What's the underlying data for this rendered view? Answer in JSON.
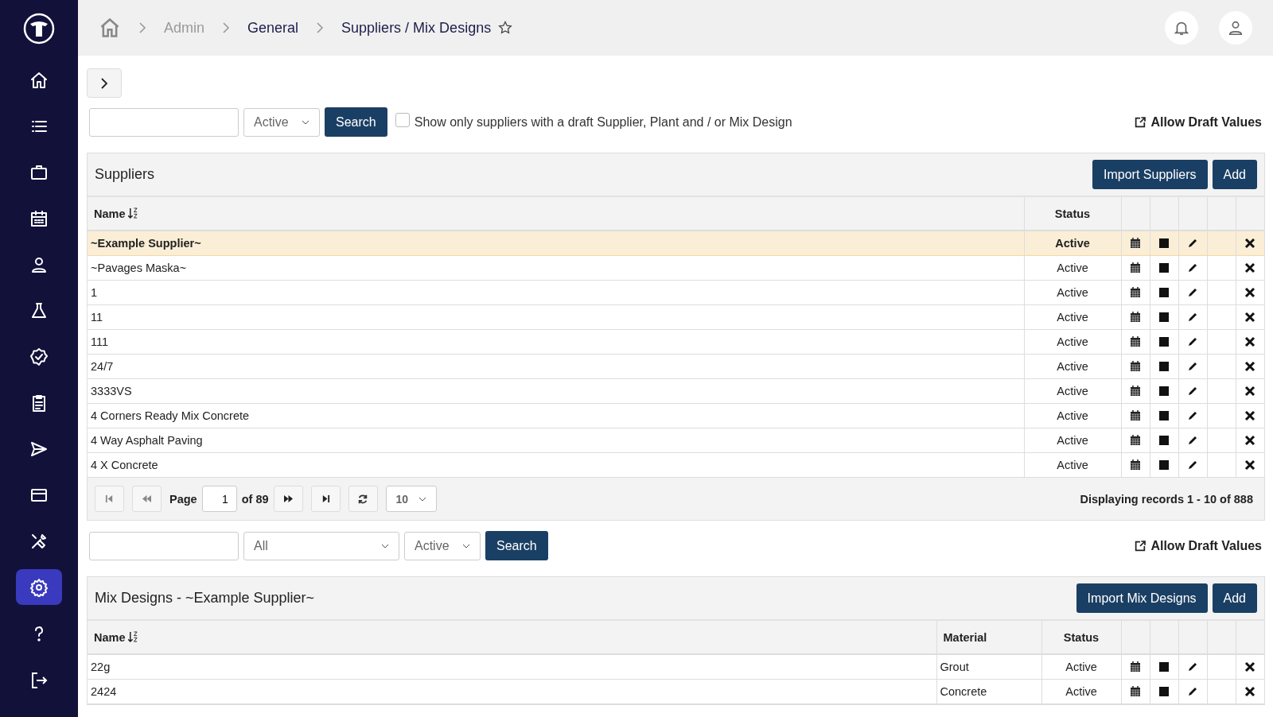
{
  "sidebar": {
    "items": [
      {
        "kind": "home",
        "selected": false
      },
      {
        "kind": "list",
        "selected": false
      },
      {
        "kind": "briefcase",
        "selected": false
      },
      {
        "kind": "calendar",
        "selected": false
      },
      {
        "kind": "person",
        "selected": false
      },
      {
        "kind": "flask",
        "selected": false
      },
      {
        "kind": "badge",
        "selected": false
      },
      {
        "kind": "clipboard",
        "selected": false
      },
      {
        "kind": "send",
        "selected": false
      },
      {
        "kind": "card",
        "selected": false
      },
      {
        "kind": "tools",
        "selected": false
      },
      {
        "kind": "gear",
        "selected": true
      },
      {
        "kind": "help",
        "selected": false
      }
    ]
  },
  "breadcrumb": [
    {
      "label": "Admin",
      "kind": "muted"
    },
    {
      "label": "General",
      "kind": "link"
    },
    {
      "label": "Suppliers / Mix Designs",
      "kind": "current"
    }
  ],
  "supplier_filter": {
    "status": "Active",
    "search_button": "Search",
    "draft_checkbox": {
      "label": "Show only suppliers with a draft Supplier, Plant and / or Mix Design",
      "checked": false
    },
    "allow_draft": "Allow Draft Values"
  },
  "suppliers": {
    "title": "Suppliers",
    "buttons": [
      "Import Suppliers",
      "Add"
    ],
    "columns": [
      "Name",
      "Status"
    ],
    "rows": [
      {
        "name": "~Example Supplier~",
        "status": "Active",
        "selected": true
      },
      {
        "name": "~Pavages Maska~",
        "status": "Active",
        "selected": false
      },
      {
        "name": "1",
        "status": "Active",
        "selected": false
      },
      {
        "name": "11",
        "status": "Active",
        "selected": false
      },
      {
        "name": "111",
        "status": "Active",
        "selected": false
      },
      {
        "name": "24/7",
        "status": "Active",
        "selected": false
      },
      {
        "name": "3333VS",
        "status": "Active",
        "selected": false
      },
      {
        "name": "4 Corners Ready Mix Concrete",
        "status": "Active",
        "selected": false
      },
      {
        "name": "4 Way Asphalt Paving",
        "status": "Active",
        "selected": false
      },
      {
        "name": "4 X Concrete",
        "status": "Active",
        "selected": false
      }
    ],
    "pager": {
      "page_label": "Page",
      "page": "1",
      "of": "of 89",
      "page_size": "10",
      "summary": "Displaying records 1 - 10 of 888"
    }
  },
  "mix_filter": {
    "material": "All",
    "status": "Active",
    "search_button": "Search",
    "allow_draft": "Allow Draft Values"
  },
  "mix_designs": {
    "title": "Mix Designs - ~Example Supplier~",
    "buttons": [
      "Import Mix Designs",
      "Add"
    ],
    "columns": [
      "Name",
      "Material",
      "Status"
    ],
    "rows": [
      {
        "name": "22g",
        "material": "Grout",
        "status": "Active",
        "selected": false
      },
      {
        "name": "2424",
        "material": "Concrete",
        "status": "Active",
        "selected": false
      }
    ]
  }
}
